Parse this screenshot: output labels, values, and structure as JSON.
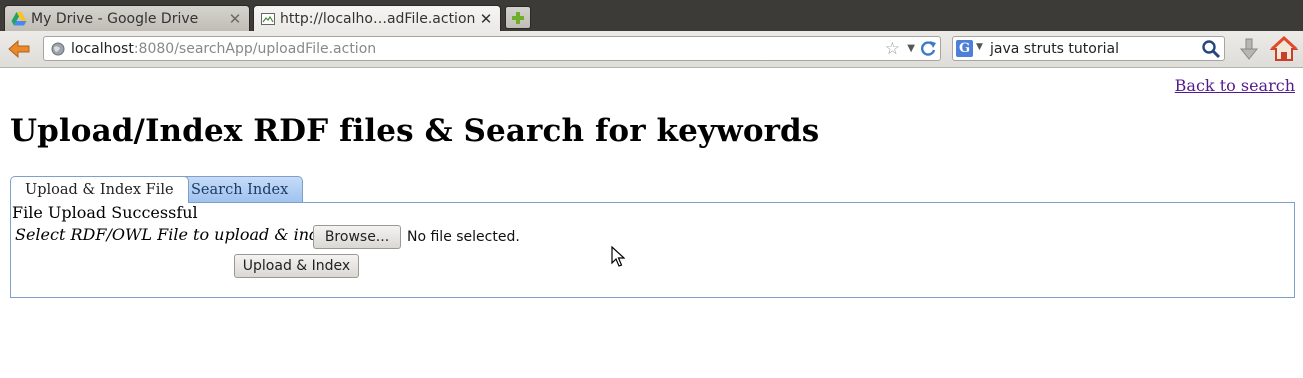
{
  "browser": {
    "tabs": [
      {
        "title": "My Drive - Google Drive",
        "active": false,
        "favicon": "google-drive-icon"
      },
      {
        "title": "http://localho…adFile.action",
        "active": true,
        "favicon": "page-icon"
      }
    ],
    "tab_close_glyph": "✕",
    "new_tab_icon": "plus-icon",
    "url": {
      "host": "localhost",
      "rest": ":8080/searchApp/uploadFile.action"
    },
    "search": {
      "engine": "G",
      "query": "java struts tutorial"
    },
    "icons": [
      "back-arrow-icon",
      "globe-icon",
      "star-icon",
      "reload-icon",
      "search-icon",
      "download-icon",
      "home-icon"
    ]
  },
  "page": {
    "back_link": "Back to search",
    "title": "Upload/Index RDF files & Search for keywords",
    "tabs": [
      "Upload & Index File",
      "Search Index"
    ],
    "status_message": "File Upload Successful",
    "file_label": "Select RDF/OWL File to upload & index:",
    "browse_label": "Browse...",
    "file_status": "No file selected.",
    "submit_label": "Upload & Index"
  },
  "colors": {
    "link": "#551a8b",
    "tab_active_bg": "#ffffff",
    "tab_inactive_bg": "#9fc3ef",
    "panel_border": "#7ea0c8",
    "back_arrow": "#e8892b",
    "home_icon": "#e04a2a"
  }
}
